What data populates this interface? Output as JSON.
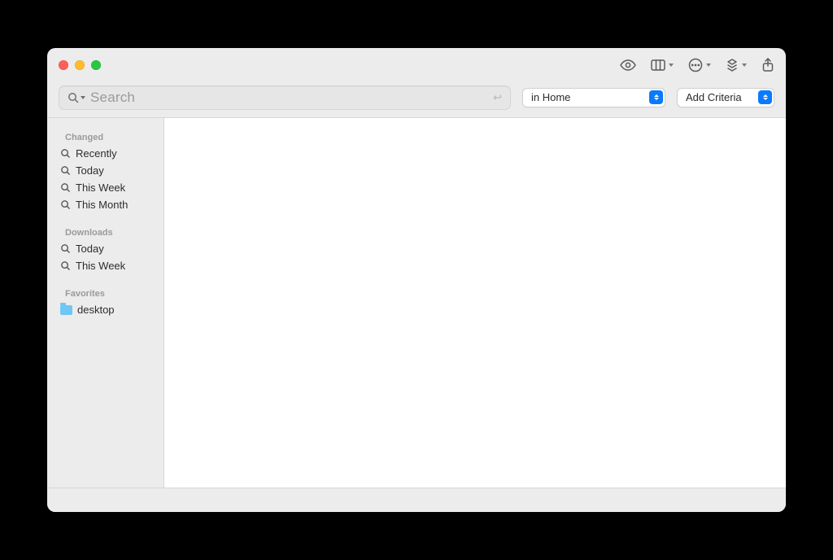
{
  "search": {
    "placeholder": "Search"
  },
  "scope": {
    "selected": "in Home"
  },
  "criteria": {
    "label": "Add Criteria"
  },
  "sidebar": {
    "sections": [
      {
        "title": "Changed",
        "items": [
          "Recently",
          "Today",
          "This Week",
          "This Month"
        ]
      },
      {
        "title": "Downloads",
        "items": [
          "Today",
          "This Week"
        ]
      },
      {
        "title": "Favorites",
        "folders": [
          "desktop"
        ]
      }
    ]
  }
}
